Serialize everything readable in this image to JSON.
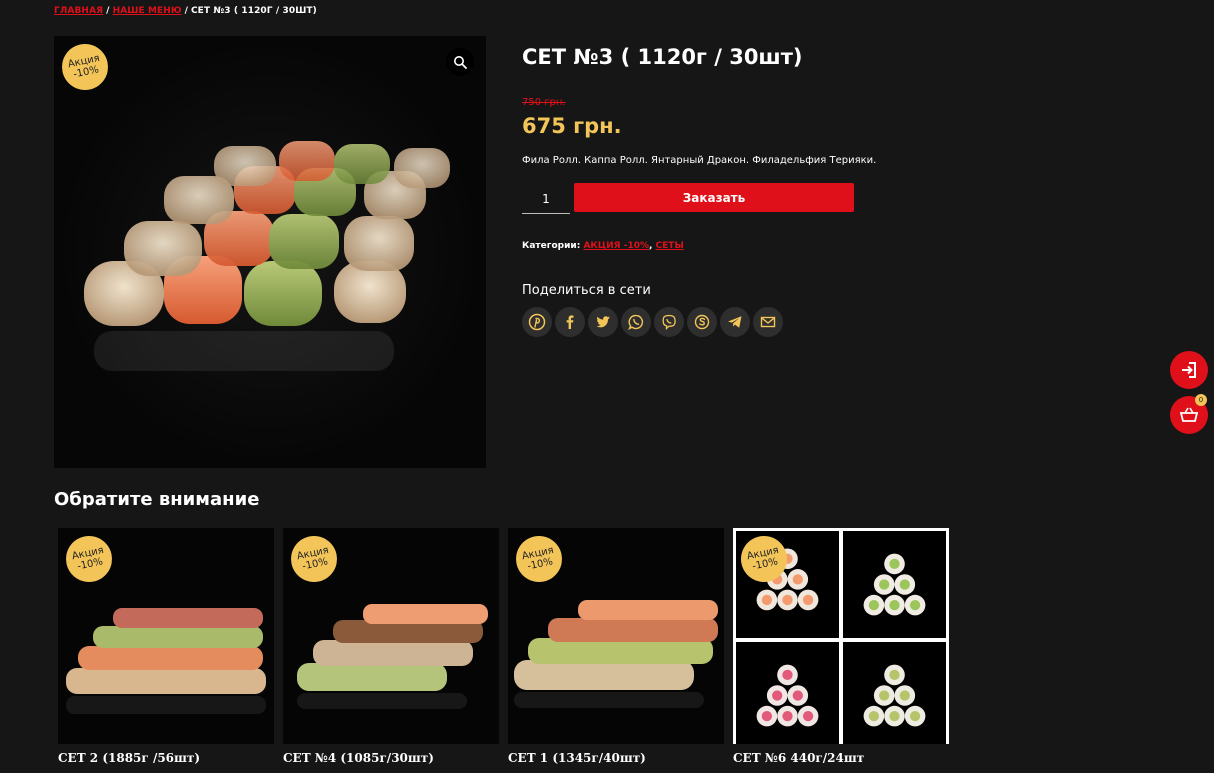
{
  "breadcrumb": {
    "home": "ГЛАВНАЯ",
    "menu": "НАШЕ МЕНЮ",
    "current": "СЕТ №3 ( 1120Г / 30ШТ)",
    "separator": "/"
  },
  "product": {
    "title": "СЕТ №3 ( 1120г / 30шт)",
    "old_price": "750 грн.",
    "price": "675 грн.",
    "description": "Фила Ролл. Каппа Ролл. Янтарный Дракон. Филадельфия Терияки.",
    "quantity": "1",
    "order_label": "Заказать",
    "categories_label": "Категории:",
    "categories": [
      "АКЦИЯ -10%",
      "СЕТЫ"
    ],
    "categories_sep": ", ",
    "badge_line1": "Акция",
    "badge_line2": "-10%"
  },
  "share": {
    "title": "Поделиться в сети",
    "icons": [
      "pinterest-icon",
      "facebook-icon",
      "twitter-icon",
      "whatsapp-icon",
      "viber-icon",
      "skype-icon",
      "telegram-icon",
      "email-icon"
    ]
  },
  "cart": {
    "count": "0"
  },
  "related": {
    "title": "Обратите внимание",
    "items": [
      {
        "name": "СЕТ 2 (1885г /56шт)",
        "badge_line1": "Акция",
        "badge_line2": "-10%"
      },
      {
        "name": "СЕТ №4 (1085г/30шт)",
        "badge_line1": "Акция",
        "badge_line2": "-10%"
      },
      {
        "name": "СЕТ 1 (1345г/40шт)",
        "badge_line1": "Акция",
        "badge_line2": "-10%"
      },
      {
        "name": "СЕТ №6 440г/24шт",
        "badge_line1": "Акция",
        "badge_line2": "-10%"
      }
    ]
  },
  "colors": {
    "accent_red": "#e0101a",
    "price_gold": "#f3c559",
    "background": "#161616"
  }
}
